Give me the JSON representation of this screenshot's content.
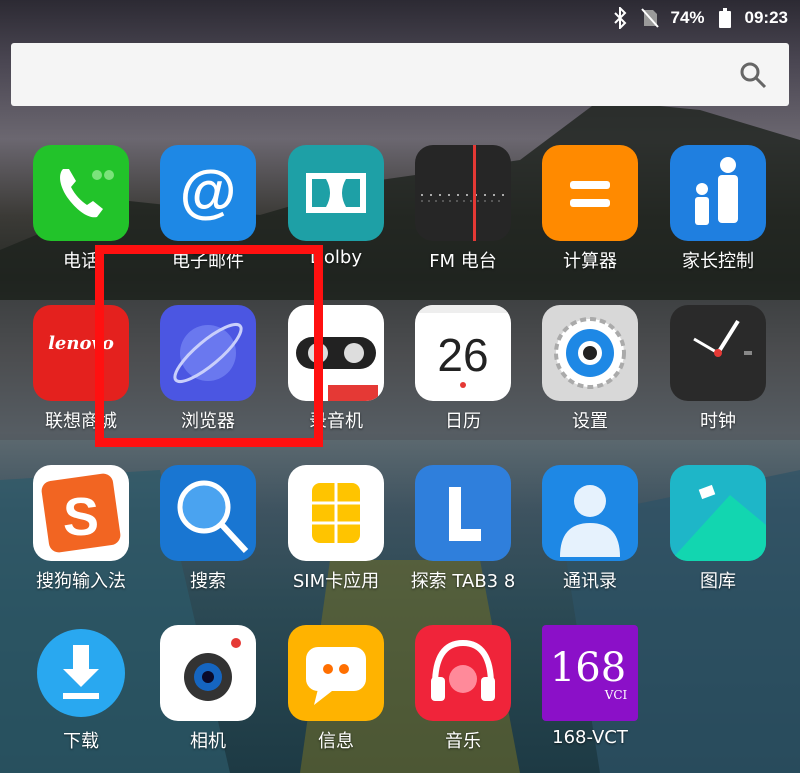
{
  "status_bar": {
    "battery_percent": "74%",
    "time": "09:23",
    "icons": [
      "bluetooth-icon",
      "no-sim-icon",
      "battery-icon"
    ]
  },
  "search": {
    "placeholder": "",
    "icon": "search-icon"
  },
  "apps": [
    {
      "label": "电话",
      "icon": "phone-icon",
      "color": "#22c32a"
    },
    {
      "label": "电子邮件",
      "icon": "email-icon",
      "color": "#1e88e5"
    },
    {
      "label": "Dolby",
      "icon": "dolby-icon",
      "color": "#1ea0a6"
    },
    {
      "label": "FM 电台",
      "icon": "fm-radio-icon",
      "color": "#262626"
    },
    {
      "label": "计算器",
      "icon": "calculator-icon",
      "color": "#ff8a00"
    },
    {
      "label": "家长控制",
      "icon": "parental-control-icon",
      "color": "#1f7fe0"
    },
    {
      "label": "联想商城",
      "icon": "lenovo-store-icon",
      "color": "#e4211e"
    },
    {
      "label": "浏览器",
      "icon": "browser-icon",
      "color": "#4b56e2"
    },
    {
      "label": "录音机",
      "icon": "recorder-icon",
      "color": "#ffffff"
    },
    {
      "label": "日历",
      "icon": "calendar-icon",
      "color": "#ffffff",
      "day": "26"
    },
    {
      "label": "设置",
      "icon": "settings-icon",
      "color": "#d8d8d8"
    },
    {
      "label": "时钟",
      "icon": "clock-icon",
      "color": "#2a2a2a"
    },
    {
      "label": "搜狗输入法",
      "icon": "sogou-input-icon",
      "color": "#ffffff"
    },
    {
      "label": "搜索",
      "icon": "search-app-icon",
      "color": "#1976d2"
    },
    {
      "label": "SIM卡应用",
      "icon": "sim-card-icon",
      "color": "#ffffff"
    },
    {
      "label": "探索 TAB3 8",
      "icon": "explore-tab3-icon",
      "color": "#2f7fdc"
    },
    {
      "label": "通讯录",
      "icon": "contacts-icon",
      "color": "#1e88e5"
    },
    {
      "label": "图库",
      "icon": "gallery-icon",
      "color": "#1eb6c8"
    },
    {
      "label": "下载",
      "icon": "download-icon",
      "color": "#29a8f0"
    },
    {
      "label": "相机",
      "icon": "camera-icon",
      "color": "#ffffff"
    },
    {
      "label": "信息",
      "icon": "messages-icon",
      "color": "#ffb300"
    },
    {
      "label": "音乐",
      "icon": "music-icon",
      "color": "#f0243a"
    },
    {
      "label": "168-VCT",
      "icon": "vct-icon",
      "color": "#8b10c8",
      "logo_text": "168",
      "logo_sub": "VCI"
    }
  ],
  "highlight_color": "#ff1010"
}
